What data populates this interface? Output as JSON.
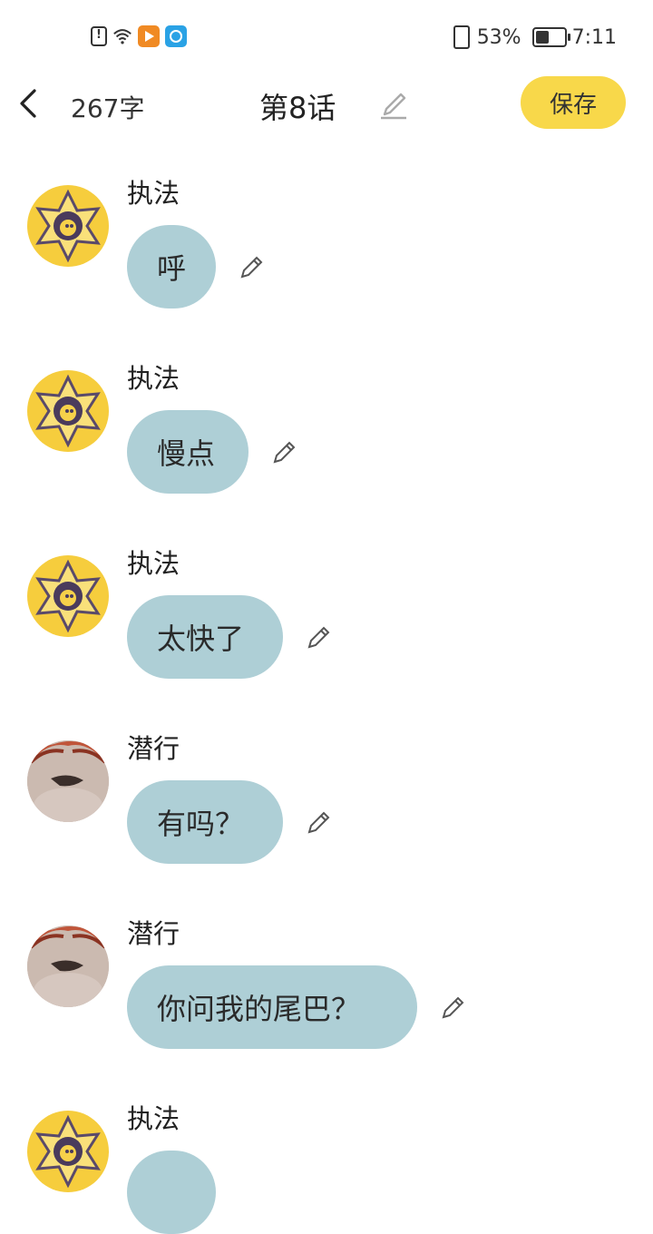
{
  "status_bar": {
    "battery": "53%",
    "time": "7:11",
    "battery_level": 0.53
  },
  "header": {
    "word_count": "267字",
    "title": "第8话",
    "save_label": "保存"
  },
  "messages": [
    {
      "name": "执法",
      "text": "呼",
      "avatar": "badge-avatar"
    },
    {
      "name": "执法",
      "text": "慢点",
      "avatar": "badge-avatar"
    },
    {
      "name": "执法",
      "text": "太快了",
      "avatar": "badge-avatar"
    },
    {
      "name": "潜行",
      "text": "有吗？",
      "avatar": "person-avatar"
    },
    {
      "name": "潜行",
      "text": "你问我的尾巴？",
      "avatar": "person-avatar"
    },
    {
      "name": "执法",
      "text": "",
      "avatar": "badge-avatar"
    }
  ],
  "colors": {
    "bubble": "#aecfd6",
    "save_button": "#f8d84a",
    "badge_avatar": "#f6cd3d"
  },
  "icons": [
    "back-arrow-icon",
    "edit-title-icon",
    "pencil-icon",
    "sim-alert-icon",
    "wifi-icon",
    "vibrate-icon",
    "battery-icon"
  ]
}
